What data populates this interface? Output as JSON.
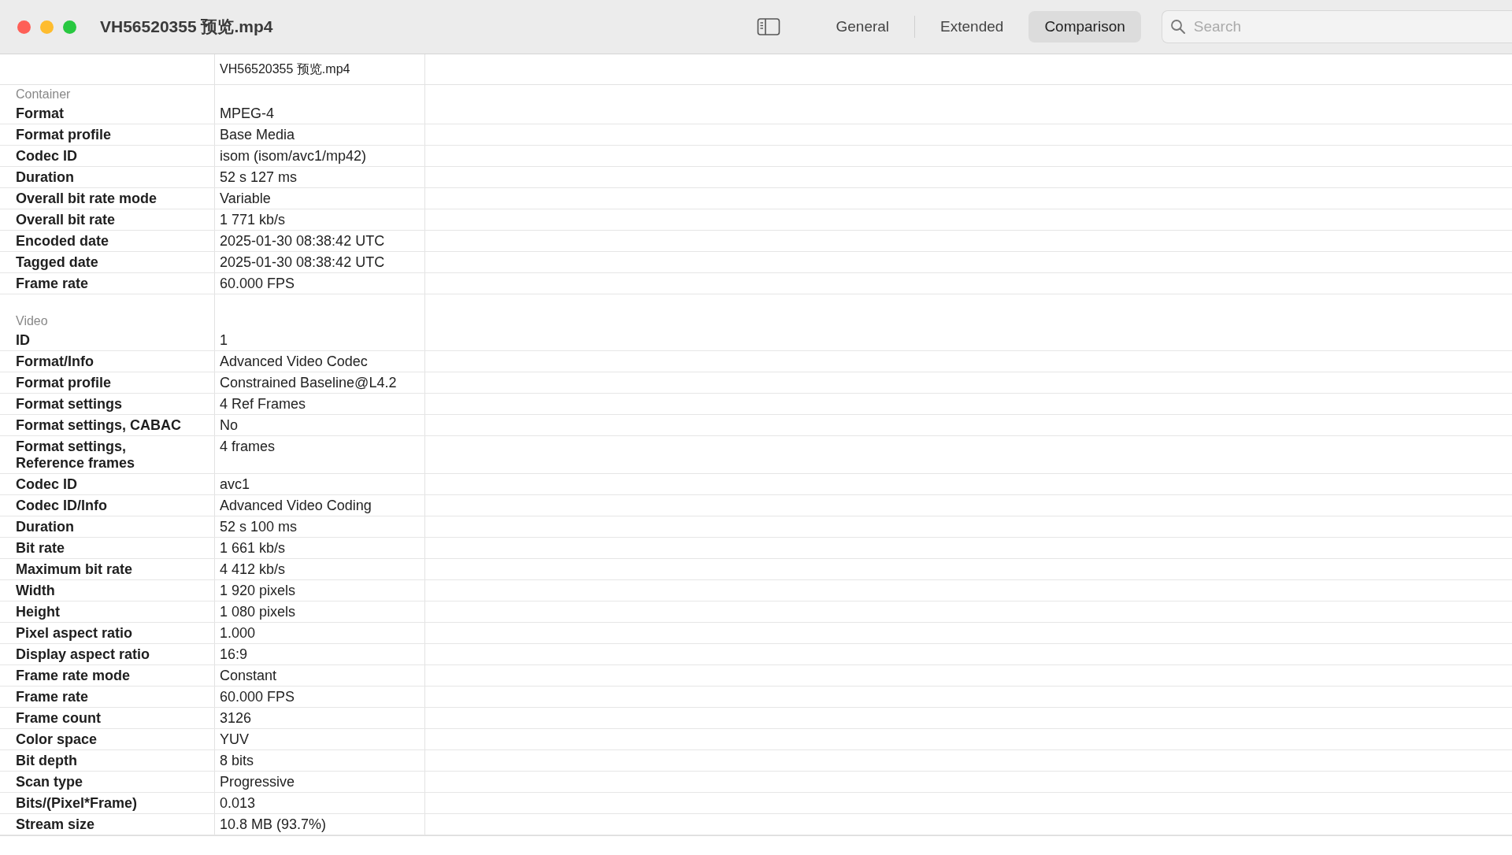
{
  "window": {
    "title": "VH56520355 预览.mp4"
  },
  "tabs": [
    {
      "label": "General",
      "selected": false
    },
    {
      "label": "Extended",
      "selected": false
    },
    {
      "label": "Comparison",
      "selected": true
    }
  ],
  "search": {
    "placeholder": "Search"
  },
  "table": {
    "file_column": "VH56520355 预览.mp4",
    "sections": [
      {
        "title": "Container",
        "rows": [
          {
            "label": "Format",
            "value": "MPEG-4"
          },
          {
            "label": "Format profile",
            "value": "Base Media"
          },
          {
            "label": "Codec ID",
            "value": "isom (isom/avc1/mp42)"
          },
          {
            "label": "Duration",
            "value": "52 s 127 ms"
          },
          {
            "label": "Overall bit rate mode",
            "value": "Variable"
          },
          {
            "label": "Overall bit rate",
            "value": "1 771 kb/s"
          },
          {
            "label": "Encoded date",
            "value": "2025-01-30 08:38:42 UTC"
          },
          {
            "label": "Tagged date",
            "value": "2025-01-30 08:38:42 UTC"
          },
          {
            "label": "Frame rate",
            "value": "60.000 FPS"
          }
        ]
      },
      {
        "title": "Video",
        "rows": [
          {
            "label": "ID",
            "value": "1"
          },
          {
            "label": "Format/Info",
            "value": "Advanced Video Codec"
          },
          {
            "label": "Format profile",
            "value": "Constrained Baseline@L4.2"
          },
          {
            "label": "Format settings",
            "value": "4 Ref Frames"
          },
          {
            "label": "Format settings, CABAC",
            "value": "No"
          },
          {
            "label": "Format settings, Reference frames",
            "value": "4 frames"
          },
          {
            "label": "Codec ID",
            "value": "avc1"
          },
          {
            "label": "Codec ID/Info",
            "value": "Advanced Video Coding"
          },
          {
            "label": "Duration",
            "value": "52 s 100 ms"
          },
          {
            "label": "Bit rate",
            "value": "1 661 kb/s"
          },
          {
            "label": "Maximum bit rate",
            "value": "4 412 kb/s"
          },
          {
            "label": "Width",
            "value": "1 920 pixels"
          },
          {
            "label": "Height",
            "value": "1 080 pixels"
          },
          {
            "label": "Pixel aspect ratio",
            "value": "1.000"
          },
          {
            "label": "Display aspect ratio",
            "value": "16:9"
          },
          {
            "label": "Frame rate mode",
            "value": "Constant"
          },
          {
            "label": "Frame rate",
            "value": "60.000 FPS"
          },
          {
            "label": "Frame count",
            "value": "3126"
          },
          {
            "label": "Color space",
            "value": "YUV"
          },
          {
            "label": "Bit depth",
            "value": "8 bits"
          },
          {
            "label": "Scan type",
            "value": "Progressive"
          },
          {
            "label": "Bits/(Pixel*Frame)",
            "value": "0.013"
          },
          {
            "label": "Stream size",
            "value": "10.8 MB (93.7%)"
          }
        ]
      }
    ]
  }
}
